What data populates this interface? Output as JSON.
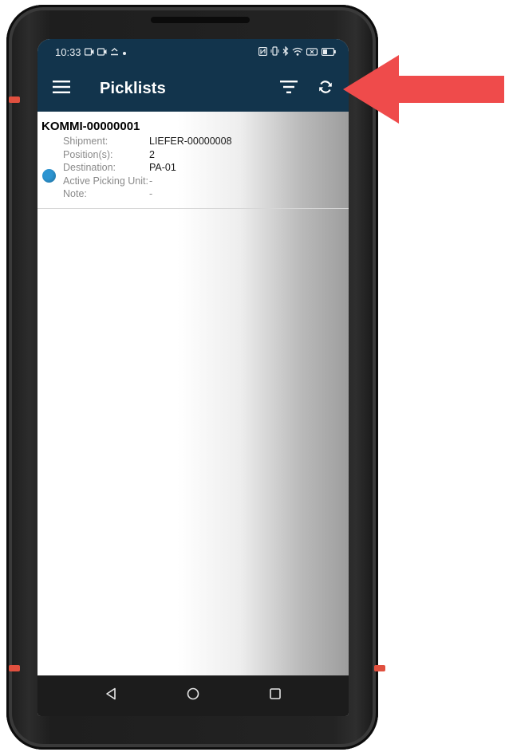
{
  "status_bar": {
    "time": "10:33",
    "icons_left": [
      "video-icon",
      "video-icon",
      "download-icon",
      "dot-icon"
    ],
    "icons_right": [
      "nfc-icon",
      "vibrate-icon",
      "bluetooth-icon",
      "wifi-icon",
      "battery-saver-icon",
      "battery-icon"
    ]
  },
  "app_bar": {
    "title": "Picklists",
    "menu_icon": "hamburger-icon",
    "filter_icon": "filter-icon",
    "refresh_icon": "refresh-icon",
    "background": "#12344c"
  },
  "picklists": [
    {
      "id": "KOMMI-00000001",
      "status_color": "#2c94d1",
      "fields": [
        {
          "label": "Shipment:",
          "value": "LIEFER-00000008"
        },
        {
          "label": "Position(s):",
          "value": "2"
        },
        {
          "label": "Destination:",
          "value": "PA-01"
        },
        {
          "label": "Active Picking Unit:",
          "value": "-"
        },
        {
          "label": "Note:",
          "value": "-"
        }
      ]
    }
  ],
  "nav_bar": {
    "back_icon": "back-triangle-icon",
    "home_icon": "home-circle-icon",
    "recents_icon": "recents-square-icon"
  },
  "annotation": {
    "arrow_color": "#ef4b4b"
  }
}
